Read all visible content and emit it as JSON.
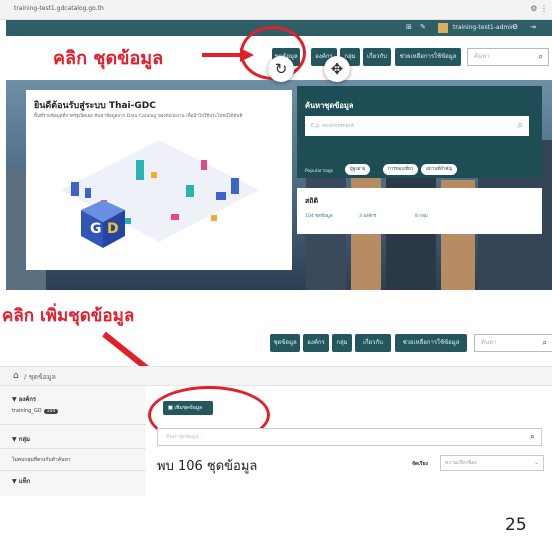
{
  "browser": {
    "url": "training-test1.gdcatalog.go.th"
  },
  "callouts": {
    "top": "คลิก ชุดข้อมูล",
    "bottom": "คลิก เพิ่มชุดข้อมูล"
  },
  "top_screen": {
    "user": "training-test1-admin",
    "nav_items": [
      "ชุดข้อมูล",
      "องค์กร",
      "กลุ่ม",
      "เกี่ยวกับ",
      "ช่วยเหลือการใช้ข้อมูล"
    ],
    "search_placeholder": "ค้นหา",
    "welcome_title": "ยินดีต้อนรับสู่ระบบ Thai-GDC",
    "welcome_sub": "พื้นที่รวมข้อมูลที่ภาครัฐเปิดเผย ค้นหาข้อมูลจาก Data Catalog ของหน่วยงาน เพื่อนำไปใช้ประโยชน์ได้ทันที",
    "search_heading": "ค้นหาชุดข้อมูล",
    "search_input_placeholder": "E.g. environment",
    "popular_tags_label": "Popular tags",
    "popular_tags": [
      "ผู้สูงอายุ",
      "การท่องเที่ยว",
      "สถานที่สำคัญ"
    ],
    "stats_heading": "สถิติ",
    "stats": [
      "104 ชุดข้อมูล",
      "3 องค์กร",
      "8 กลุ่ม"
    ]
  },
  "bottom_screen": {
    "nav_items": [
      "ชุดข้อมูล",
      "องค์กร",
      "กลุ่ม",
      "เกี่ยวกับ",
      "ช่วยเหลือการใช้ข้อมูล"
    ],
    "search_placeholder": "ค้นหา",
    "breadcrumb": "/ ชุดข้อมูล",
    "sidebar": {
      "org_heading": "องค์กร",
      "org_item": "training_GD",
      "org_count": "104",
      "group_heading": "กลุ่ม",
      "group_item": "ไม่พบกลุ่มที่ตรงกับคำค้นหา",
      "tag_heading": "แท็ก"
    },
    "add_button": "เพิ่มชุดข้อมูล",
    "filter_placeholder": "ค้นหาชุดข้อมูล...",
    "found_text": "พบ 106 ชุดข้อมูล",
    "sort_label": "จัดเรียง",
    "sort_value": "ความเกี่ยวข้อง"
  },
  "page_number": "25",
  "colors": {
    "accent": "#24565e",
    "callout": "#e0212c"
  }
}
